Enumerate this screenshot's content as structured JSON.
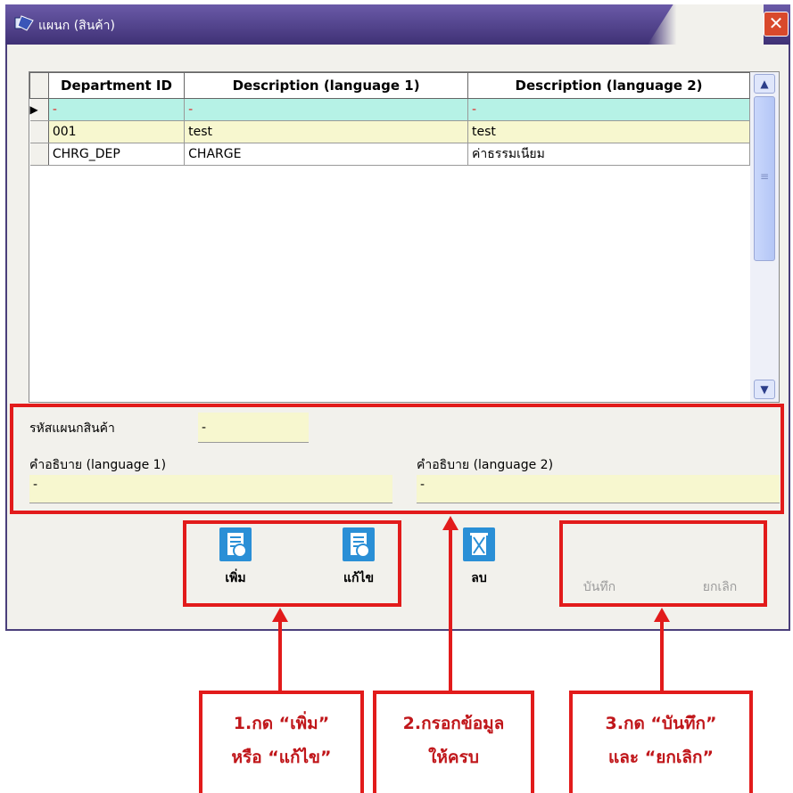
{
  "window": {
    "title": "แผนก (สินค้า)",
    "close_glyph": "✕"
  },
  "grid": {
    "columns": [
      "Department ID",
      "Description (language 1)",
      "Description (language 2)"
    ],
    "rows": [
      {
        "id": "-",
        "desc1": "-",
        "desc2": "-",
        "current": true
      },
      {
        "id": "001",
        "desc1": "test",
        "desc2": "test"
      },
      {
        "id": "CHRG_DEP",
        "desc1": "CHARGE",
        "desc2": "ค่าธรรมเนียม"
      }
    ],
    "row_pointer": "▶",
    "scroll_up": "▲",
    "scroll_down": "▼",
    "scroll_grip": "≡"
  },
  "form": {
    "code_label": "รหัสแผนกสินค้า",
    "code_value": "-",
    "desc1_label": "คำอธิบาย (language 1)",
    "desc1_value": "-",
    "desc2_label": "คำอธิบาย (language 2)",
    "desc2_value": "-"
  },
  "toolbar": {
    "add_label": "เพิ่ม",
    "edit_label": "แก้ไข",
    "delete_label": "ลบ",
    "save_label": "บันทึก",
    "cancel_label": "ยกเลิก"
  },
  "notes": {
    "step1_line1": "1.กด “เพิ่ม”",
    "step1_line2": "หรือ “แก้ไข”",
    "step2_line1": "2.กรอกข้อมูล",
    "step2_line2": "ให้ครบ",
    "step3_line1": "3.กด “บันทึก”",
    "step3_line2": "และ “ยกเลิก”"
  },
  "colors": {
    "highlight": "#e21b1b",
    "accent": "#2a8fd6",
    "title_bar": "#4b3c8c"
  }
}
